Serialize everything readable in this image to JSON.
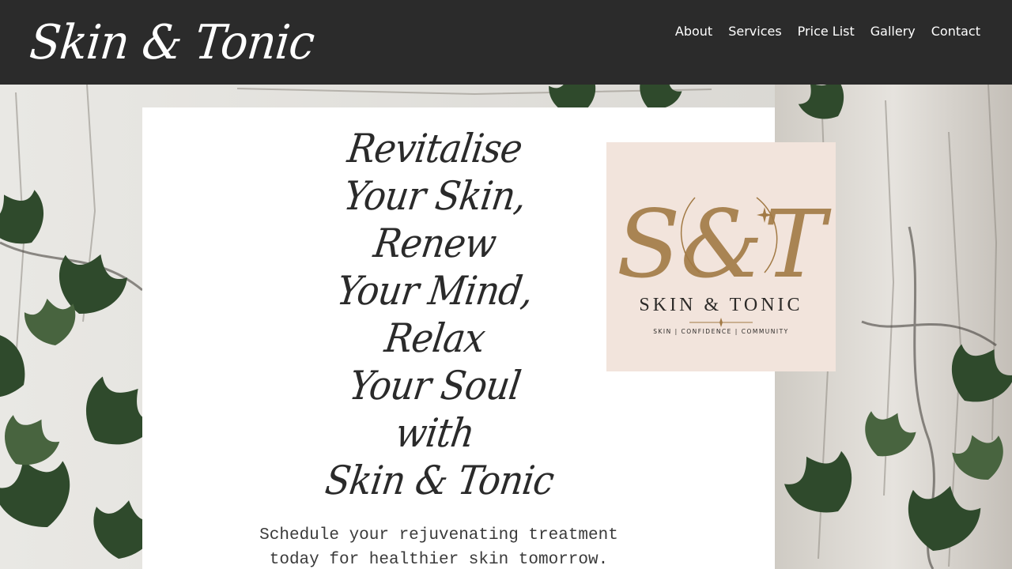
{
  "header": {
    "brand": "Skin & Tonic",
    "nav": [
      "About",
      "Services",
      "Price List",
      "Gallery",
      "Contact"
    ]
  },
  "hero": {
    "headline_lines": [
      "Revitalise",
      "Your Skin,",
      "Renew",
      "Your Mind,",
      "Relax",
      "Your Soul",
      "with",
      "Skin & Tonic"
    ],
    "tagline_lines": [
      "Schedule your rejuvenating treatment",
      "today for healthier skin tomorrow."
    ]
  },
  "logo": {
    "monogram": "S&T",
    "name": "SKIN & TONIC",
    "subtitle": "SKIN | CONFIDENCE | COMMUNITY"
  },
  "colors": {
    "header_bg": "#2b2b2b",
    "card_bg": "#ffffff",
    "logo_bg": "#f2e4dc",
    "logo_gold": "#a27a45"
  }
}
